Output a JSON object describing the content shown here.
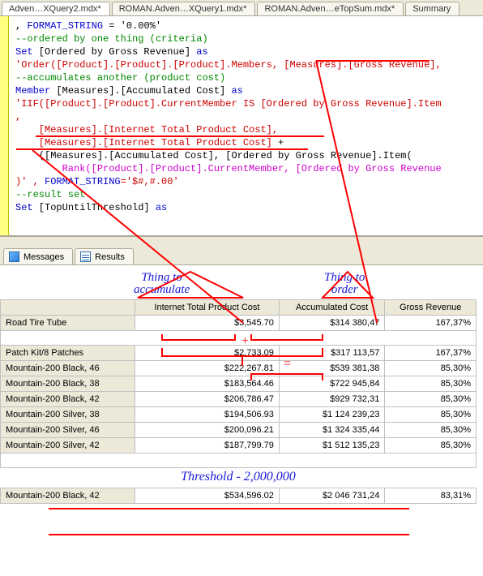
{
  "tabs": {
    "items": [
      {
        "label": "Adven…XQuery2.mdx*",
        "active": true
      },
      {
        "label": "ROMAN.Adven…XQuery1.mdx*",
        "active": false
      },
      {
        "label": "ROMAN.Adven…eTopSum.mdx*",
        "active": false
      },
      {
        "label": "Summary",
        "active": false
      }
    ]
  },
  "code": {
    "l1_a": ", ",
    "l1_b": "FORMAT_STRING",
    "l1_c": " = '0.00%'",
    "l2": "--ordered by one thing (criteria)",
    "l3_a": "Set",
    "l3_b": " [Ordered by Gross Revenue] ",
    "l3_c": "as",
    "l4": "'Order([Product].[Product].[Product].Members, [Measures].[Gross Revenue],",
    "l5": "--accumulates another (product cost)",
    "l6_a": "Member",
    "l6_b": " [Measures].[Accumulated Cost] ",
    "l6_c": "as",
    "l7": "'IIF([Product].[Product].CurrentMember IS [Ordered by Gross Revenue].Item",
    "l8": ",",
    "l9": "    [Measures].[Internet Total Product Cost],",
    "l10a": "    [Measures].[Internet Total Product Cost]",
    "l10b": " +",
    "l11": "    ([Measures].[Accumulated Cost], [Ordered by Gross Revenue].Item(",
    "l12": "        Rank([Product].[Product].CurrentMember, [Ordered by Gross Revenue",
    "l13a": ")' , ",
    "l13b": "FORMAT_STRING",
    "l13c": "='$#,#.00'",
    "l14": "--result set",
    "l15_a": "Set",
    "l15_b": " [TopUntilThreshold] ",
    "l15_c": "as"
  },
  "midtabs": {
    "messages": "Messages",
    "results": "Results"
  },
  "annotations": {
    "accumulate": "Thing to\naccumulate",
    "order": "Thing to\norder",
    "threshold": "Threshold  - 2,000,000",
    "plus": "+",
    "equals": "="
  },
  "grid": {
    "headers": {
      "row": "",
      "itpc": "Internet Total Product Cost",
      "acc": "Accumulated Cost",
      "gr": "Gross Revenue"
    },
    "block1": [
      {
        "row": "Road Tire Tube",
        "itpc": "$3,545.70",
        "acc": "$314 380,47",
        "gr": "167,37%"
      }
    ],
    "block2": [
      {
        "row": "Patch Kit/8 Patches",
        "itpc": "$2,733.09",
        "acc": "$317 113,57",
        "gr": "167,37%"
      },
      {
        "row": "Mountain-200 Black, 46",
        "itpc": "$222,267.81",
        "acc": "$539 381,38",
        "gr": "85,30%"
      },
      {
        "row": "Mountain-200 Black, 38",
        "itpc": "$183,564.46",
        "acc": "$722 945,84",
        "gr": "85,30%"
      },
      {
        "row": "Mountain-200 Black, 42",
        "itpc": "$206,786.47",
        "acc": "$929 732,31",
        "gr": "85,30%"
      },
      {
        "row": "Mountain-200 Silver, 38",
        "itpc": "$194,506.93",
        "acc": "$1 124 239,23",
        "gr": "85,30%"
      },
      {
        "row": "Mountain-200 Silver, 46",
        "itpc": "$200,096.21",
        "acc": "$1 324 335,44",
        "gr": "85,30%"
      },
      {
        "row": "Mountain-200 Silver, 42",
        "itpc": "$187,799.79",
        "acc": "$1 512 135,23",
        "gr": "85,30%"
      }
    ],
    "block3": [
      {
        "row": "Mountain-200 Black, 42",
        "itpc": "$534,596.02",
        "acc": "$2 046 731,24",
        "gr": "83,31%"
      }
    ]
  }
}
